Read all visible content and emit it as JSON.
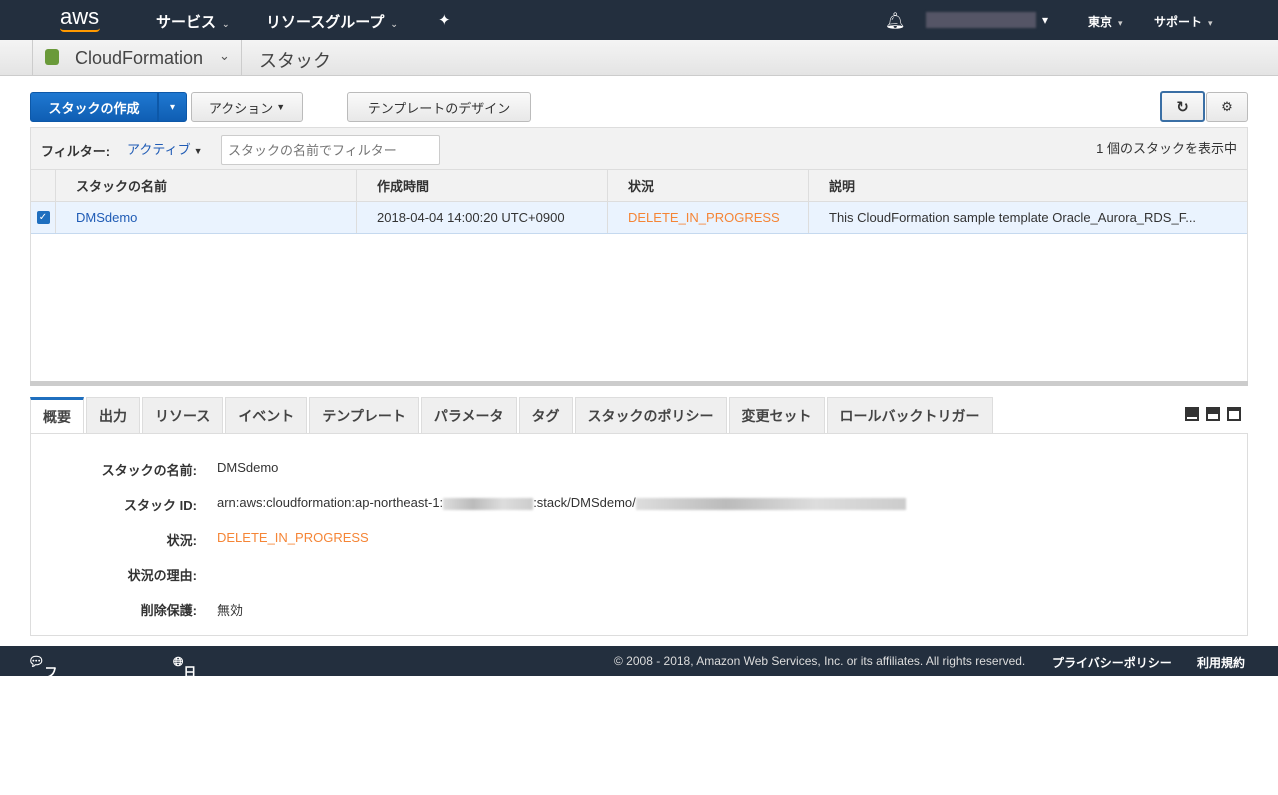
{
  "nav": {
    "logo": "aws",
    "services": "サービス",
    "resource_groups": "リソースグループ",
    "account": "",
    "region": "東京",
    "support": "サポート"
  },
  "sub": {
    "service": "CloudFormation",
    "page": "スタック"
  },
  "toolbar": {
    "create": "スタックの作成",
    "actions": "アクション",
    "design": "テンプレートのデザイン"
  },
  "filter": {
    "label": "フィルター:",
    "value": "アクティブ",
    "placeholder": "スタックの名前でフィルター",
    "count": "1 個のスタックを表示中"
  },
  "table": {
    "headers": [
      "スタックの名前",
      "作成時間",
      "状況",
      "説明"
    ],
    "rows": [
      {
        "name": "DMSdemo",
        "created": "2018-04-04 14:00:20 UTC+0900",
        "status": "DELETE_IN_PROGRESS",
        "desc": "This CloudFormation sample template Oracle_Aurora_RDS_F..."
      }
    ]
  },
  "tabs": [
    "概要",
    "出力",
    "リソース",
    "イベント",
    "テンプレート",
    "パラメータ",
    "タグ",
    "スタックのポリシー",
    "変更セット",
    "ロールバックトリガー"
  ],
  "detail": {
    "name_label": "スタックの名前:",
    "name": "DMSdemo",
    "id_label": "スタック ID:",
    "id_prefix": "arn:aws:cloudformation:ap-northeast-1:",
    "id_mid": ":stack/DMSdemo/",
    "status_label": "状況:",
    "status": "DELETE_IN_PROGRESS",
    "reason_label": "状況の理由:",
    "protect_label": "削除保護:",
    "protect": "無効"
  },
  "footer": {
    "feedback": "フィードバック",
    "language": "日本語",
    "copyright": "© 2008 - 2018, Amazon Web Services, Inc. or its affiliates. All rights reserved.",
    "privacy": "プライバシーポリシー",
    "terms": "利用規約"
  },
  "colors": {
    "nav": "#232f3e",
    "primary": "#1f6fbf",
    "status": "#f58536"
  }
}
